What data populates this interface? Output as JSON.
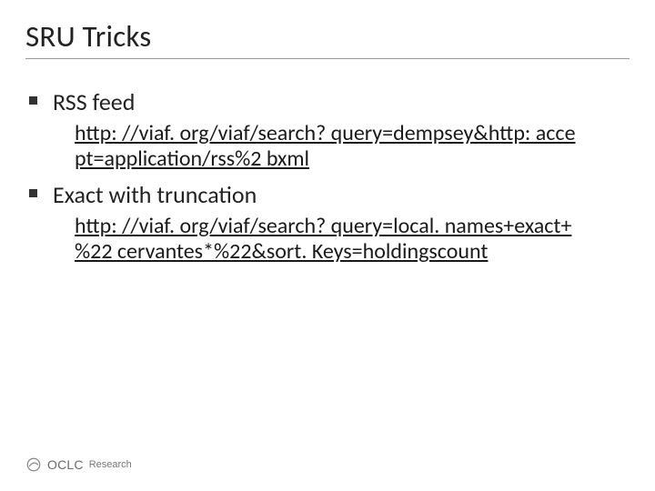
{
  "title": "SRU Tricks",
  "items": [
    {
      "label": "RSS feed",
      "link": "http: //viaf. org/viaf/search? query=dempsey&http: acce pt=application/rss%2 bxml"
    },
    {
      "label": "Exact with truncation",
      "link": "http: //viaf. org/viaf/search? query=local. names+exact+ %22 cervantes*%22&sort. Keys=holdingscount"
    }
  ],
  "footer": {
    "brand": "OCLC",
    "research": "Research"
  }
}
